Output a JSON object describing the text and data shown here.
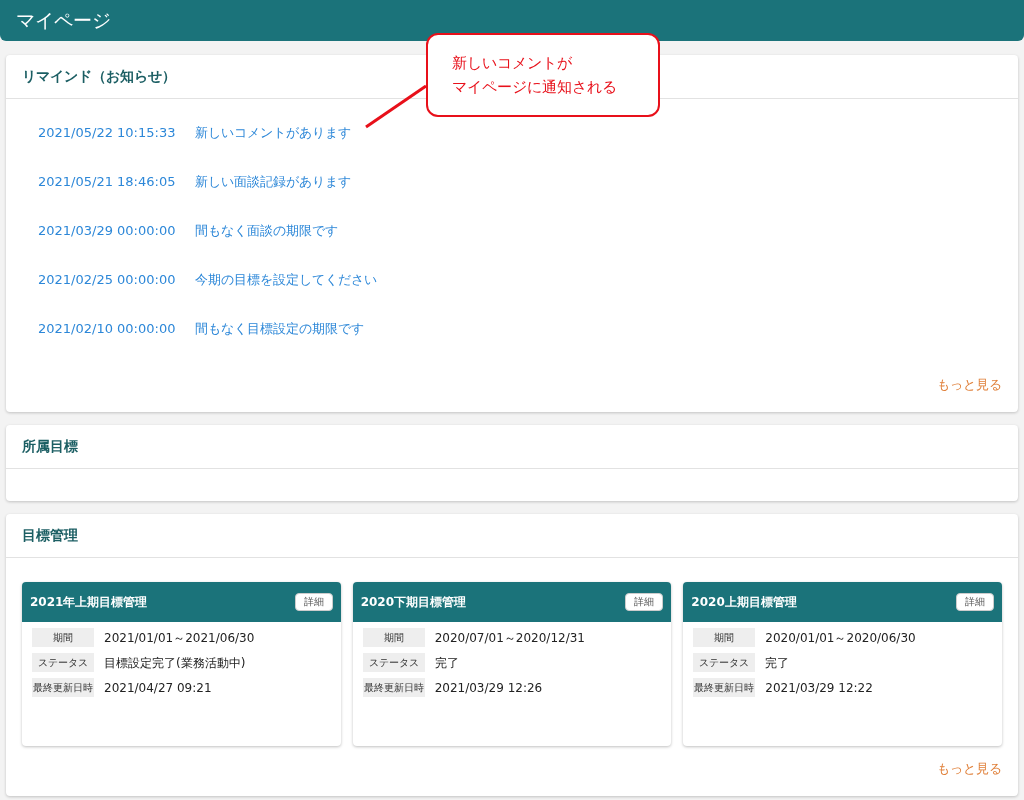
{
  "header": {
    "title": "マイページ"
  },
  "callout": {
    "lines": [
      "新しいコメントが",
      "マイページに通知される"
    ]
  },
  "reminders": {
    "title": "リマインド（お知らせ）",
    "items": [
      {
        "date": "2021/05/22 10:15:33",
        "message": "新しいコメントがあります"
      },
      {
        "date": "2021/05/21 18:46:05",
        "message": "新しい面談記録があります"
      },
      {
        "date": "2021/03/29 00:00:00",
        "message": "間もなく面談の期限です"
      },
      {
        "date": "2021/02/25 00:00:00",
        "message": "今期の目標を設定してください"
      },
      {
        "date": "2021/02/10 00:00:00",
        "message": "間もなく目標設定の期限です"
      }
    ],
    "more": "もっと見る"
  },
  "department_goals": {
    "title": "所属目標"
  },
  "goal_management": {
    "title": "目標管理",
    "cards": [
      {
        "title": "2021年上期目標管理",
        "button": "詳細",
        "fields": [
          {
            "label": "期間",
            "value": "2021/01/01～2021/06/30"
          },
          {
            "label": "ステータス",
            "value": "目標設定完了(業務活動中)"
          },
          {
            "label": "最終更新日時",
            "value": "2021/04/27 09:21"
          }
        ]
      },
      {
        "title": "2020下期目標管理",
        "button": "詳細",
        "fields": [
          {
            "label": "期間",
            "value": "2020/07/01～2020/12/31"
          },
          {
            "label": "ステータス",
            "value": "完了"
          },
          {
            "label": "最終更新日時",
            "value": "2021/03/29 12:26"
          }
        ]
      },
      {
        "title": "2020上期目標管理",
        "button": "詳細",
        "fields": [
          {
            "label": "期間",
            "value": "2020/01/01～2020/06/30"
          },
          {
            "label": "ステータス",
            "value": "完了"
          },
          {
            "label": "最終更新日時",
            "value": "2021/03/29 12:22"
          }
        ]
      }
    ],
    "more": "もっと見る"
  }
}
